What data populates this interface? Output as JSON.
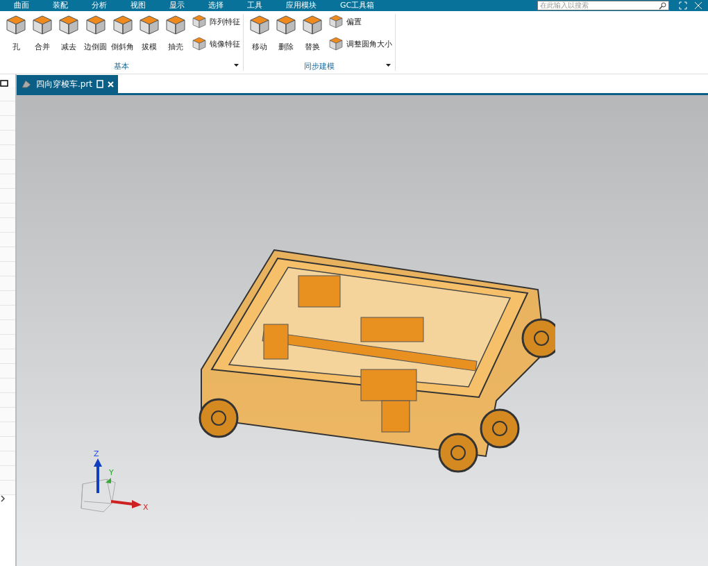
{
  "menu_tabs": [
    "曲面",
    "装配",
    "分析",
    "视图",
    "显示",
    "选择",
    "工具",
    "应用模块",
    "GC工具箱"
  ],
  "search": {
    "placeholder": "在此输入以搜索"
  },
  "ribbon_groups": [
    {
      "label": "基本",
      "large_buttons": [
        "孔",
        "合并",
        "减去",
        "边倒圆",
        "倒斜角",
        "拔模",
        "抽壳"
      ],
      "small_buttons": [
        "阵列特征",
        "镜像特征"
      ]
    },
    {
      "label": "同步建模",
      "large_buttons": [
        "移动",
        "删除",
        "替换"
      ],
      "small_buttons": [
        "偏置",
        "调整圆角大小"
      ]
    }
  ],
  "document_tab": {
    "title": "四向穿梭车.prt"
  },
  "triad": {
    "x_label": "X",
    "y_label": "Y",
    "z_label": "Z"
  }
}
